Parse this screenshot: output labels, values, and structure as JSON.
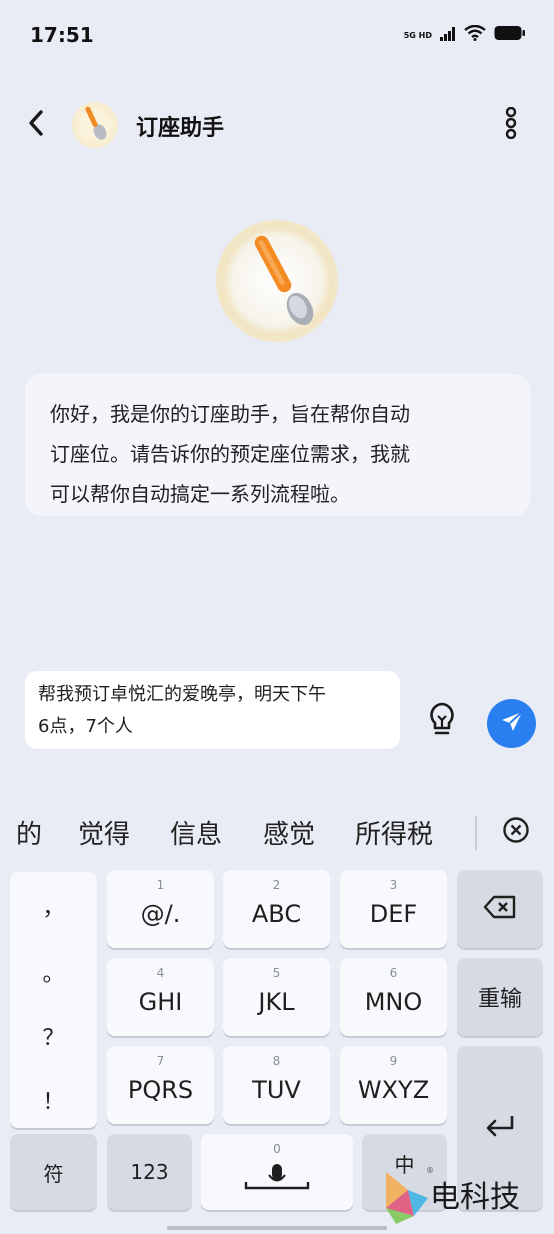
{
  "status_bar": {
    "time": "17:51",
    "network_top": "5G HD",
    "icons": [
      "signal-icon",
      "wifi-icon",
      "battery-icon"
    ]
  },
  "header": {
    "title": "订座助手",
    "back_icon": "back-arrow-icon",
    "more_icon": "more-vertical-icon",
    "avatar_icon": "spoon-icon"
  },
  "hero": {
    "avatar_icon": "spoon-icon"
  },
  "greeting": {
    "lines": [
      "你好，我是你的订座助手，旨在帮你自动",
      "订座位。请告诉你的预定座位需求，我就",
      "可以帮你自动搞定一系列流程啦。"
    ]
  },
  "composer": {
    "lines": [
      "帮我预订卓悦汇的爱晚亭，明天下午",
      "6点，7个人"
    ],
    "hint_icon": "lightbulb-icon",
    "send_icon": "send-icon",
    "accent": "#2a7ff0"
  },
  "suggestions": {
    "items": [
      "的",
      "觉得",
      "信息",
      "感觉",
      "所得税"
    ],
    "close_icon": "close-circle-icon"
  },
  "keyboard": {
    "punct": [
      "，",
      "。",
      "？",
      "！"
    ],
    "keys": [
      {
        "num": "1",
        "label": "@/."
      },
      {
        "num": "2",
        "label": "ABC"
      },
      {
        "num": "3",
        "label": "DEF"
      },
      {
        "num": "4",
        "label": "GHI"
      },
      {
        "num": "5",
        "label": "JKL"
      },
      {
        "num": "6",
        "label": "MNO"
      },
      {
        "num": "7",
        "label": "PQRS"
      },
      {
        "num": "8",
        "label": "TUV"
      },
      {
        "num": "9",
        "label": "WXYZ"
      }
    ],
    "backspace_icon": "backspace-icon",
    "retype_label": "重输",
    "enter_icon": "enter-icon",
    "symbol_label": "符",
    "num_label": "123",
    "space_num": "0",
    "mic_icon": "microphone-icon",
    "lang_label": "中"
  },
  "watermark": {
    "text": "电科技",
    "reg": "®"
  }
}
